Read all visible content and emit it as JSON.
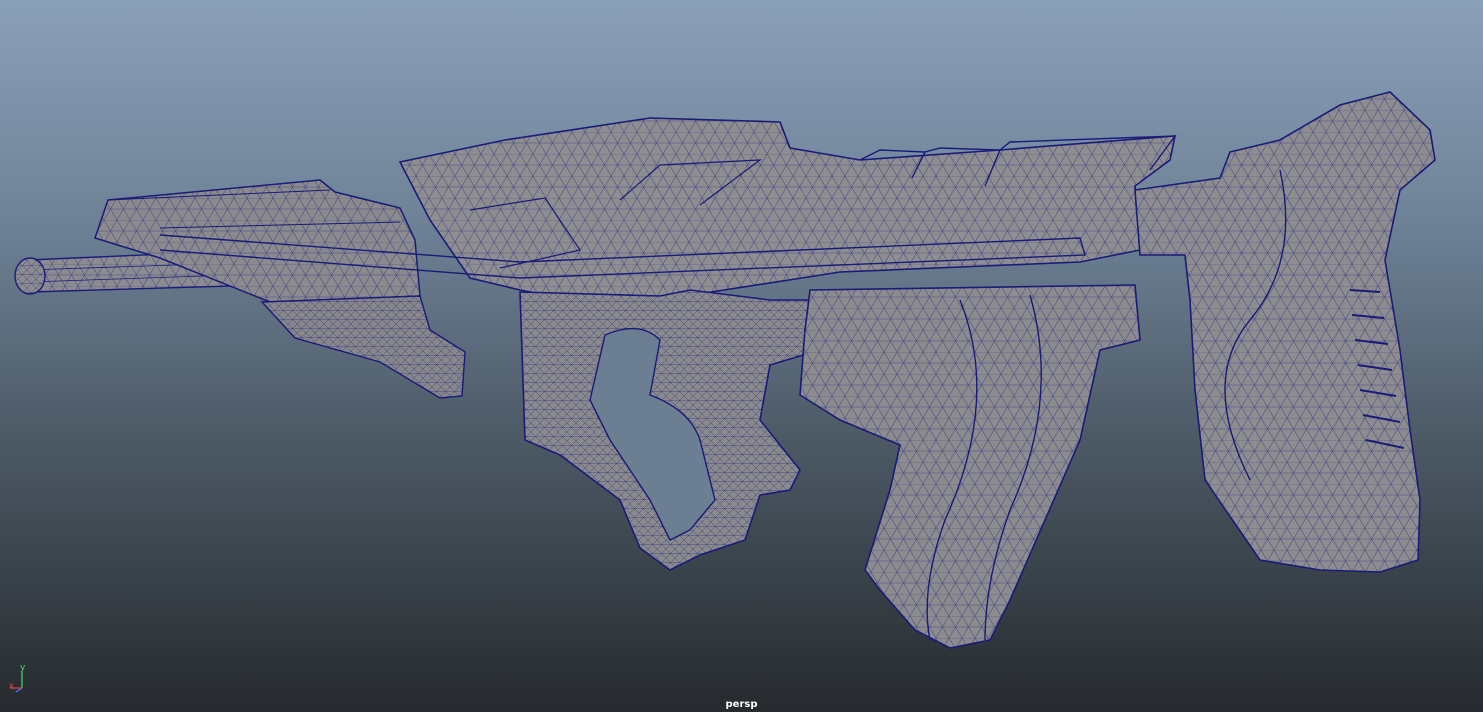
{
  "viewport": {
    "camera_label": "persp",
    "shading_mode": "wireframe-on-shaded",
    "background_colors": {
      "top": "#8aa0b8",
      "bottom": "#262a2e"
    },
    "model": {
      "subject": "rifle",
      "shaded_color": "#8d8d8f",
      "wire_color": "#1a1a78"
    },
    "axis_gizmo": {
      "y_label": "y",
      "x_label": "x",
      "y_color": "#44e060",
      "x_color": "#e04848",
      "z_color": "#5a6cff"
    }
  }
}
